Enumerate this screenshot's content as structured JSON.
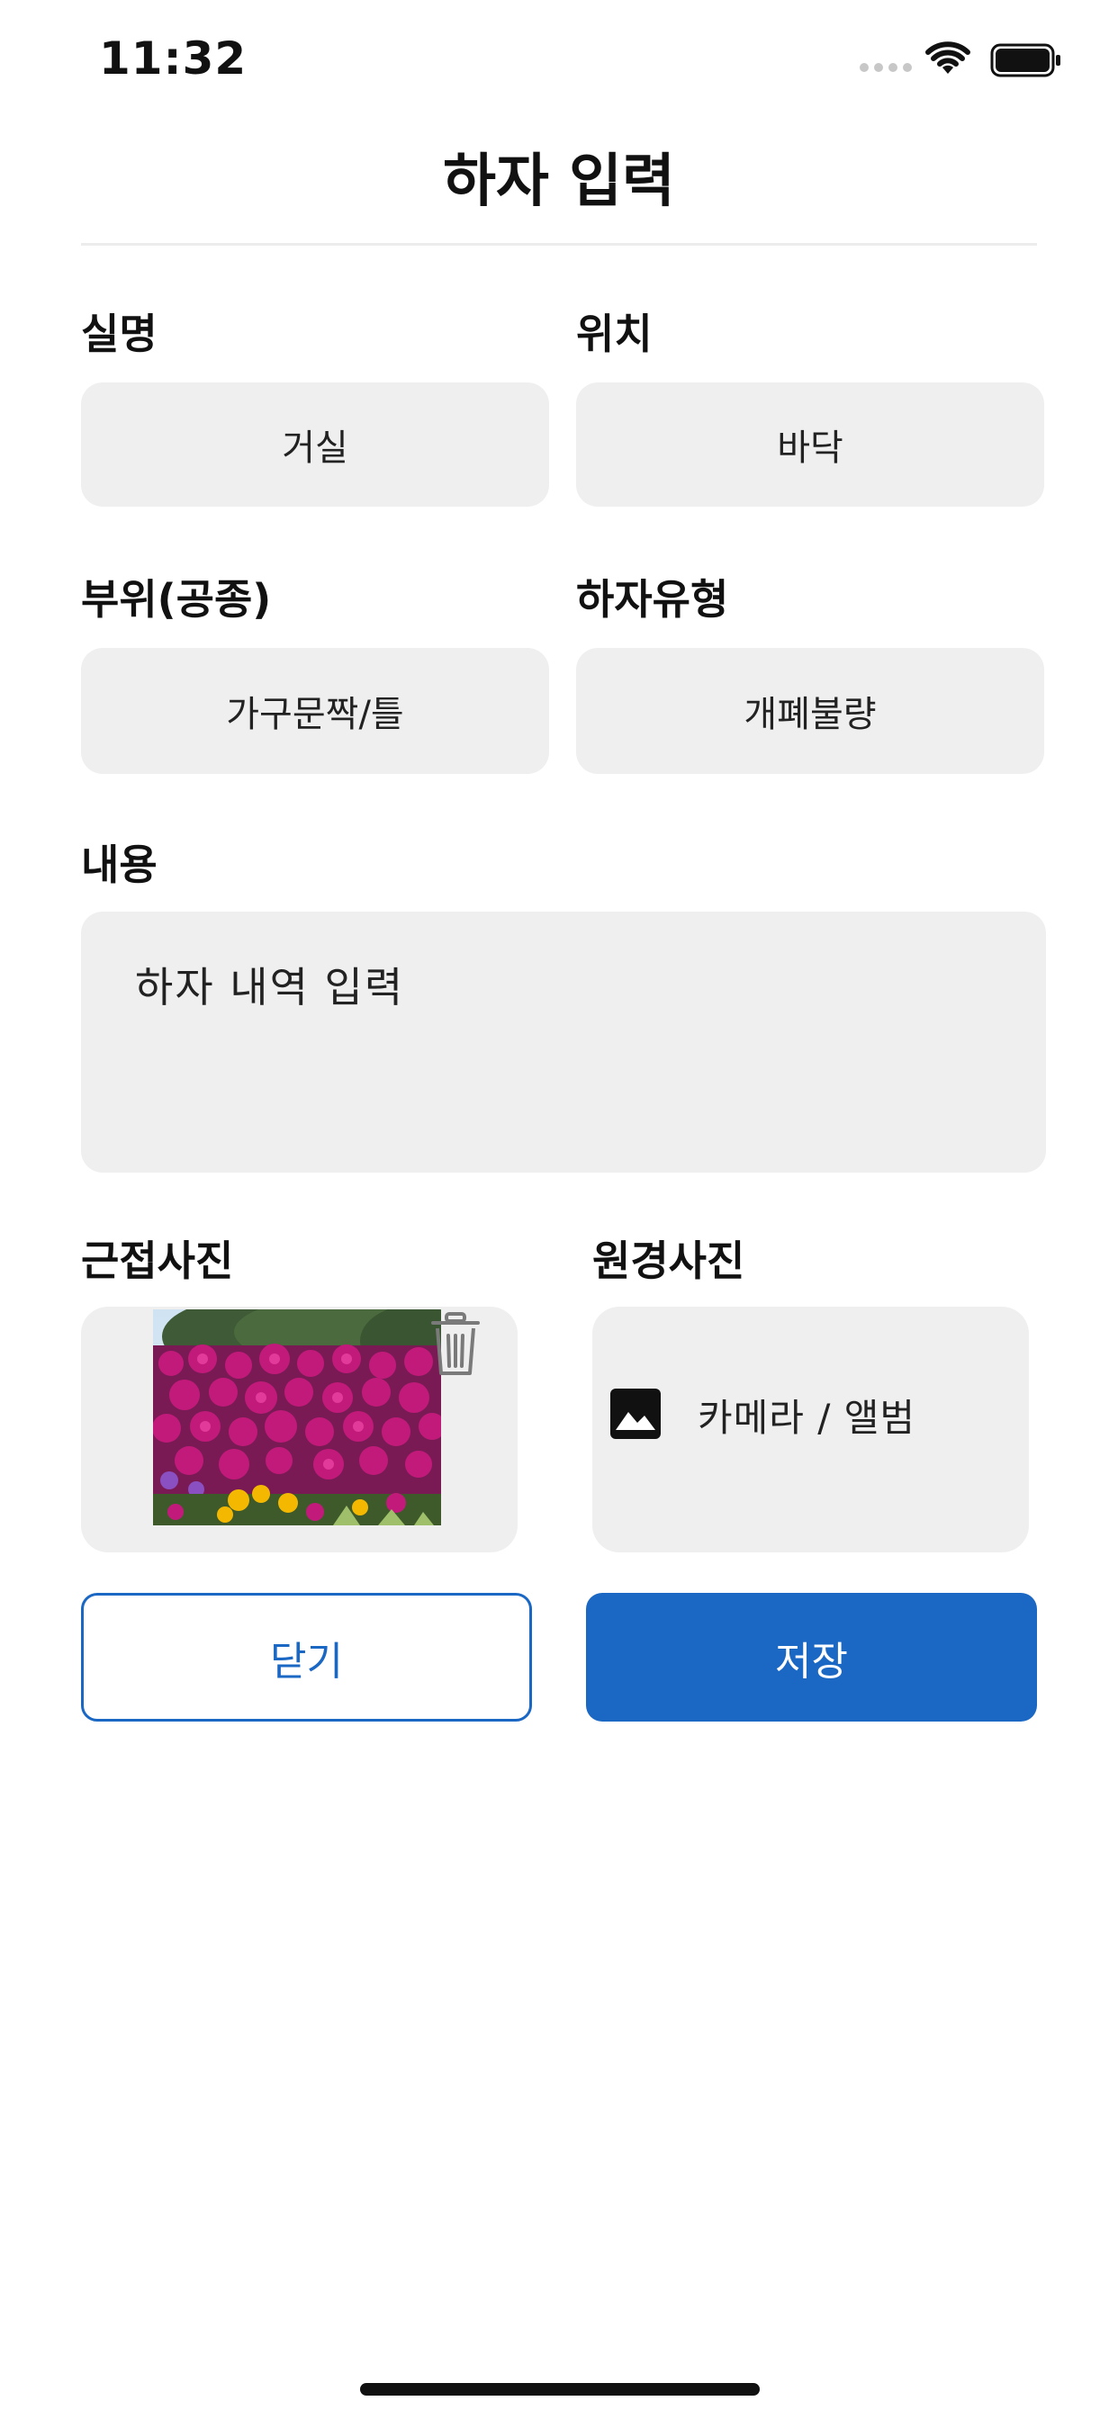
{
  "status_bar": {
    "time": "11:32"
  },
  "header": {
    "title": "하자 입력"
  },
  "form": {
    "room": {
      "label": "실명",
      "value": "거실"
    },
    "location": {
      "label": "위치",
      "value": "바닥"
    },
    "part": {
      "label": "부위(공종)",
      "value": "가구문짝/틀"
    },
    "defect_type": {
      "label": "하자유형",
      "value": "개폐불량"
    },
    "content": {
      "label": "내용",
      "placeholder": "하자 내역 입력"
    },
    "close_photo": {
      "label": "근접사진"
    },
    "far_photo": {
      "label": "원경사진",
      "action_label": "카메라 / 앨범"
    }
  },
  "buttons": {
    "close_label": "닫기",
    "save_label": "저장"
  },
  "colors": {
    "accent": "#1a67c4",
    "field_bg": "#efefef"
  },
  "icons": [
    "wifi-icon",
    "battery-icon",
    "trash-icon",
    "image-icon"
  ]
}
